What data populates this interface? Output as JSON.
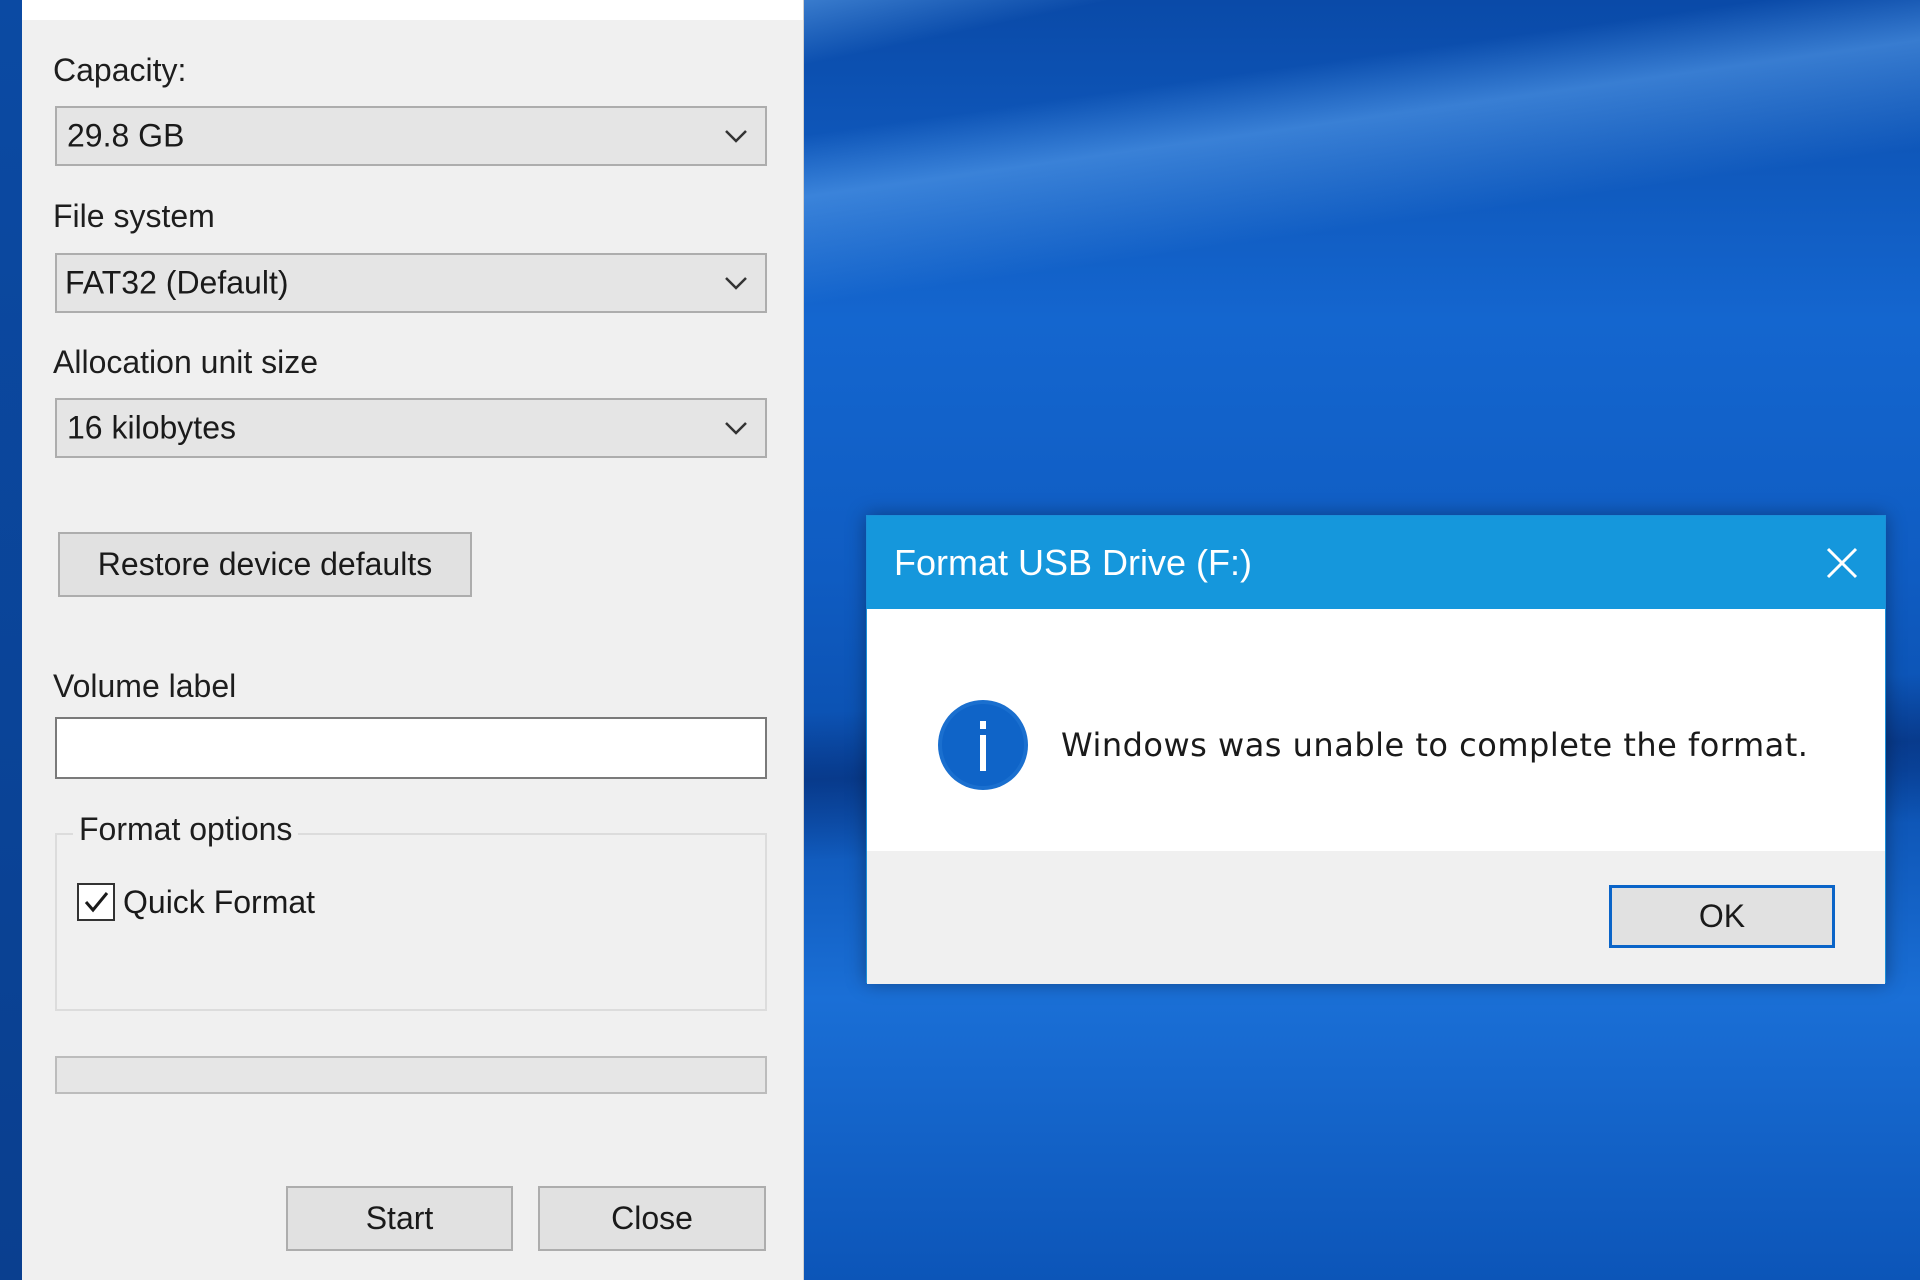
{
  "format_window": {
    "capacity": {
      "label": "Capacity:",
      "value": "29.8 GB"
    },
    "file_system": {
      "label": "File system",
      "value": "FAT32 (Default)"
    },
    "allocation_unit_size": {
      "label": "Allocation unit size",
      "value": "16 kilobytes"
    },
    "restore_defaults_label": "Restore device defaults",
    "volume_label": {
      "label": "Volume label",
      "value": ""
    },
    "format_options": {
      "title": "Format options",
      "quick_format_label": "Quick Format",
      "quick_format_checked": true
    },
    "progress_percent": 0,
    "buttons": {
      "start_label": "Start",
      "close_label": "Close"
    }
  },
  "dialog": {
    "title": "Format USB Drive (F:)",
    "message": "Windows was unable to complete the format.",
    "ok_label": "OK",
    "icon": "info-icon",
    "accent_color": "#1597dc"
  }
}
